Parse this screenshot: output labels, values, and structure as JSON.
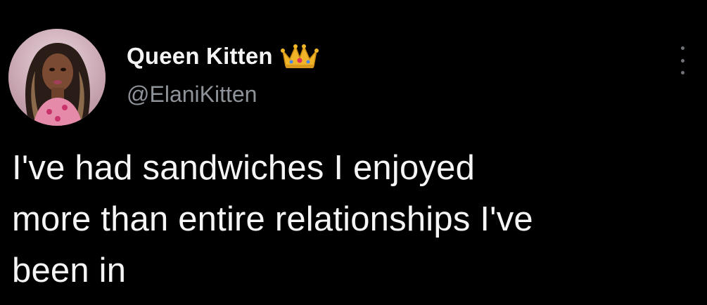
{
  "tweet": {
    "author": {
      "display_name": "Queen Kitten",
      "handle": "@ElaniKitten",
      "badge_icon": "crown-emoji",
      "avatar_icon": "profile-photo"
    },
    "more_icon": "vertical-ellipsis-icon",
    "text": "I've had sandwiches I enjoyed\nmore than entire relationships I've\nbeen in"
  },
  "colors": {
    "background": "#000000",
    "name_text": "#f4f4f4",
    "handle_text": "#8e939a",
    "body_text": "#f5f5f5",
    "crown_gold": "#f0b429"
  }
}
